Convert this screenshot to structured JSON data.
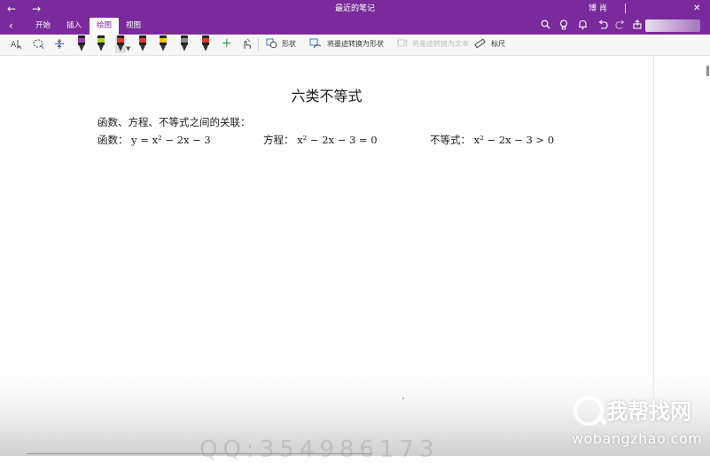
{
  "titlebar": {
    "back_icon": "←",
    "forward_icon": "→",
    "title": "最近的笔记",
    "user": "博 肖",
    "close_icon": "✕"
  },
  "ribbon": {
    "back_icon": "‹",
    "tabs": [
      {
        "label": "开始"
      },
      {
        "label": "插入"
      },
      {
        "label": "绘图",
        "active": true
      },
      {
        "label": "视图"
      }
    ],
    "right_icons": [
      "search-icon",
      "lightbulb-icon",
      "bell-icon",
      "undo-icon",
      "redo-icon",
      "share-icon"
    ]
  },
  "toolbar": {
    "pens": [
      {
        "color": "#8e44ad"
      },
      {
        "color": "#a7d129"
      },
      {
        "color": "#e53935",
        "selected": true
      },
      {
        "color": "#e53935"
      },
      {
        "color": "#f1c40f"
      },
      {
        "color": "#7f8c8d"
      },
      {
        "color": "#e53935"
      }
    ],
    "shapes_label": "形状",
    "ink_to_shape_label": "将墨迹转换为形状",
    "ink_to_text_label": "将墨迹转换为文本",
    "ruler_label": "标尺"
  },
  "page": {
    "title": "六类不等式",
    "relation_text": "函数、方程、不等式之间的关联：",
    "rows": [
      {
        "label": "函数：",
        "expr": "y = x² − 2x − 3"
      },
      {
        "label": "方程：",
        "expr": "x² − 2x − 3 = 0"
      },
      {
        "label": "不等式：",
        "expr": "x² − 2x − 3 > 0"
      }
    ]
  },
  "watermark": {
    "cn": "我帮找网",
    "url": "wobangzhao.com",
    "faint_digits": "QQ:354986173"
  }
}
